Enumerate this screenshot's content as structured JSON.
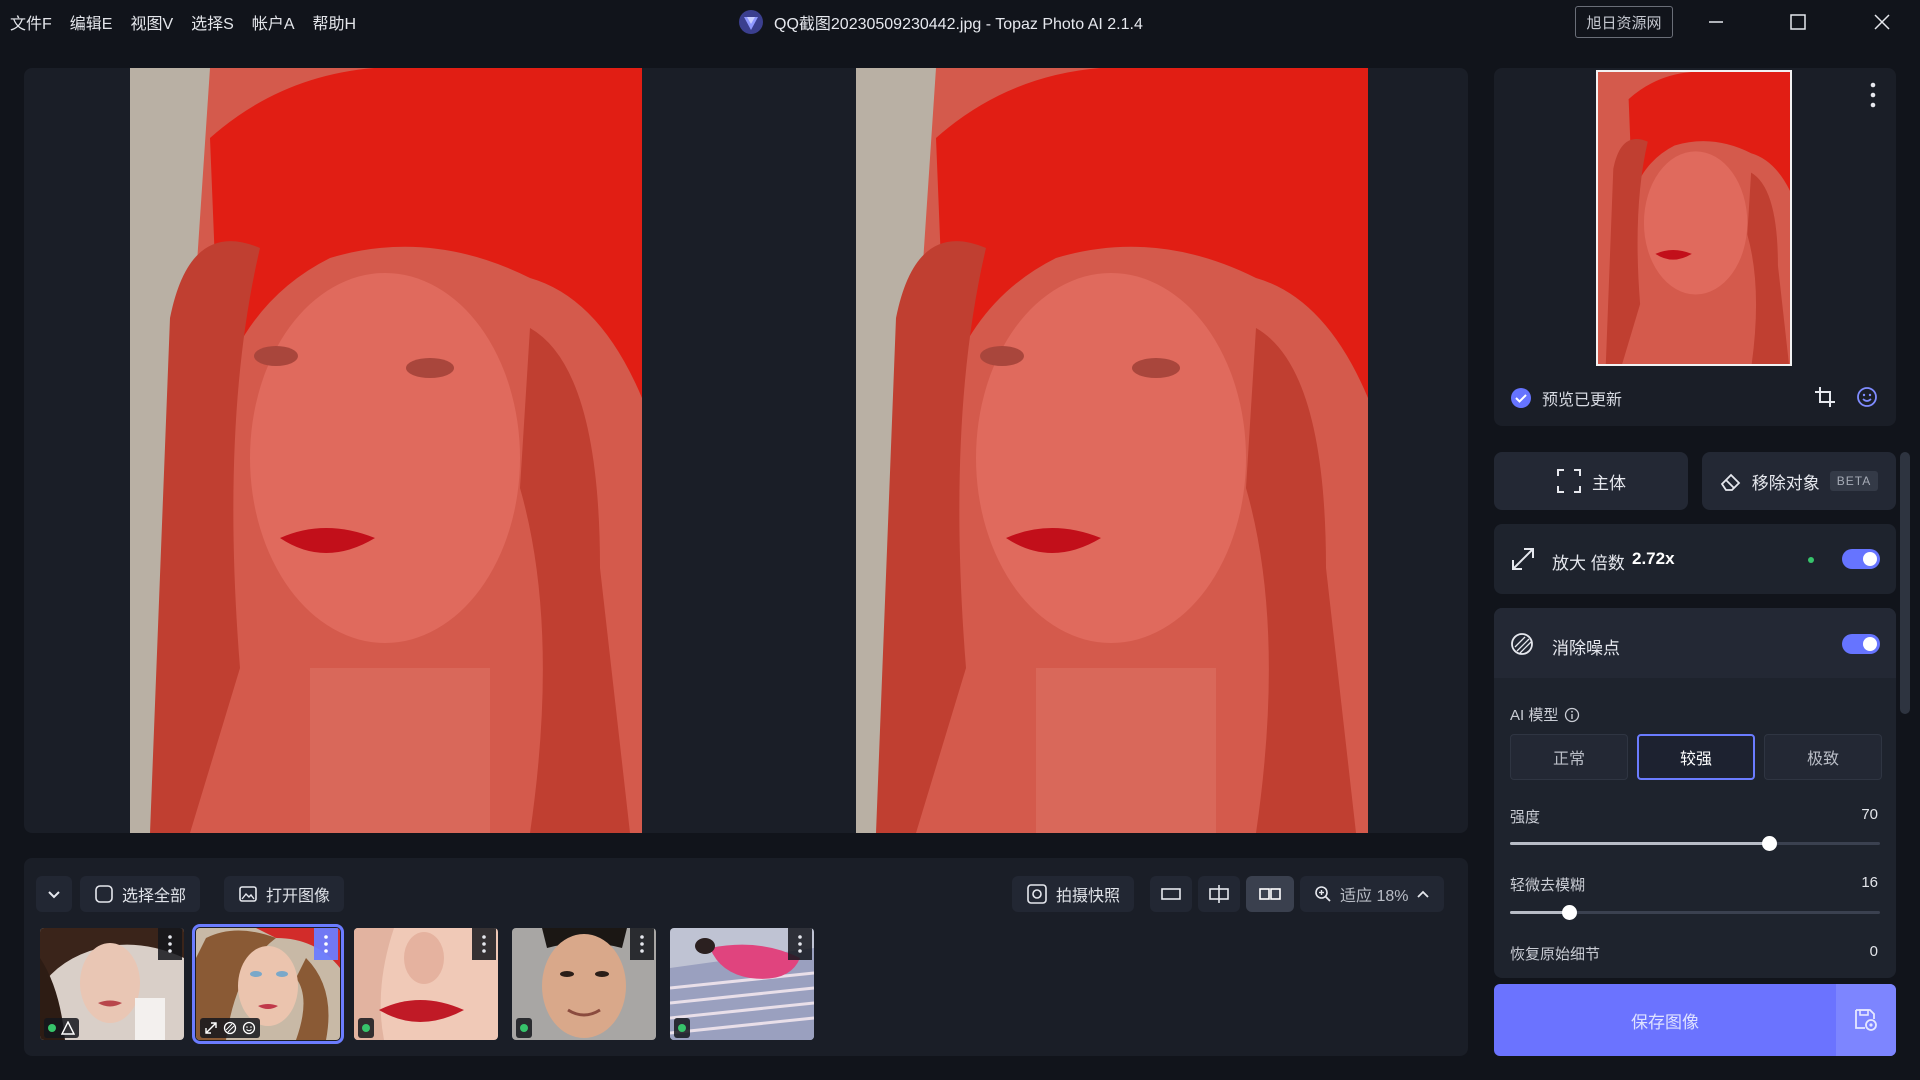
{
  "menu": [
    "文件F",
    "编辑E",
    "视图V",
    "选择S",
    "帐户A",
    "帮助H"
  ],
  "window": {
    "title": "QQ截图20230509230442.jpg - Topaz Photo AI 2.1.4",
    "badge": "旭日资源网"
  },
  "nav": {
    "status": "预览已更新"
  },
  "modes": {
    "subject": "主体",
    "remove": "移除对象",
    "beta": "BETA"
  },
  "upscale": {
    "label": "放大 倍数",
    "factor": "2.72x",
    "enabled": true
  },
  "denoise": {
    "label": "消除噪点",
    "enabled": true,
    "model_label": "AI 模型",
    "models": [
      "正常",
      "较强",
      "极致"
    ],
    "selected_model": "较强",
    "sliders": [
      {
        "label": "强度",
        "value": 70
      },
      {
        "label": "轻微去模糊",
        "value": 16
      },
      {
        "label": "恢复原始细节",
        "value": 0
      }
    ]
  },
  "save": {
    "label": "保存图像"
  },
  "toolbar": {
    "collapse": "",
    "select_all": "选择全部",
    "open": "打开图像",
    "snapshot": "拍摄快照",
    "zoom": "适应 18%"
  },
  "colors": {
    "accent": "#6b73ff",
    "panel": "#1e232d",
    "bg": "#11141b",
    "status_dot": "#37c46b"
  }
}
